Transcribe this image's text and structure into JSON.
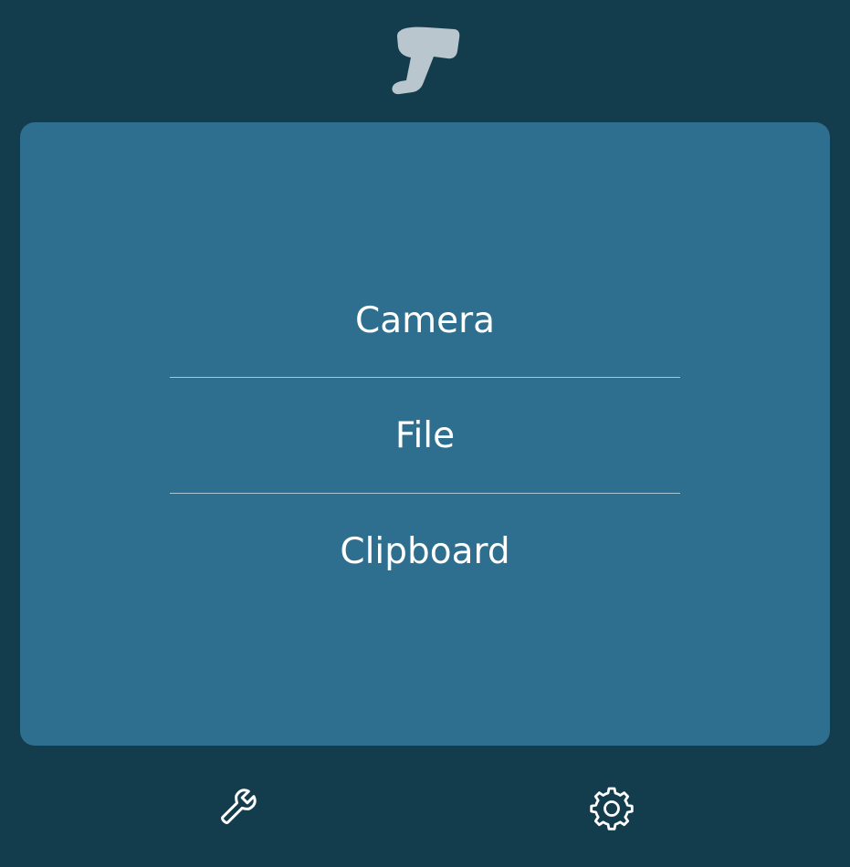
{
  "app": {
    "logo_icon": "barcode-scanner-icon"
  },
  "menu": {
    "items": [
      {
        "label": "Camera"
      },
      {
        "label": "File"
      },
      {
        "label": "Clipboard"
      }
    ]
  },
  "footer": {
    "left_icon": "wrench-icon",
    "right_icon": "gear-icon"
  },
  "colors": {
    "background": "#133c4d",
    "card": "#2e6e8e",
    "text": "#ffffff",
    "divider": "#aac7d6",
    "logo": "#b9c6cd"
  }
}
